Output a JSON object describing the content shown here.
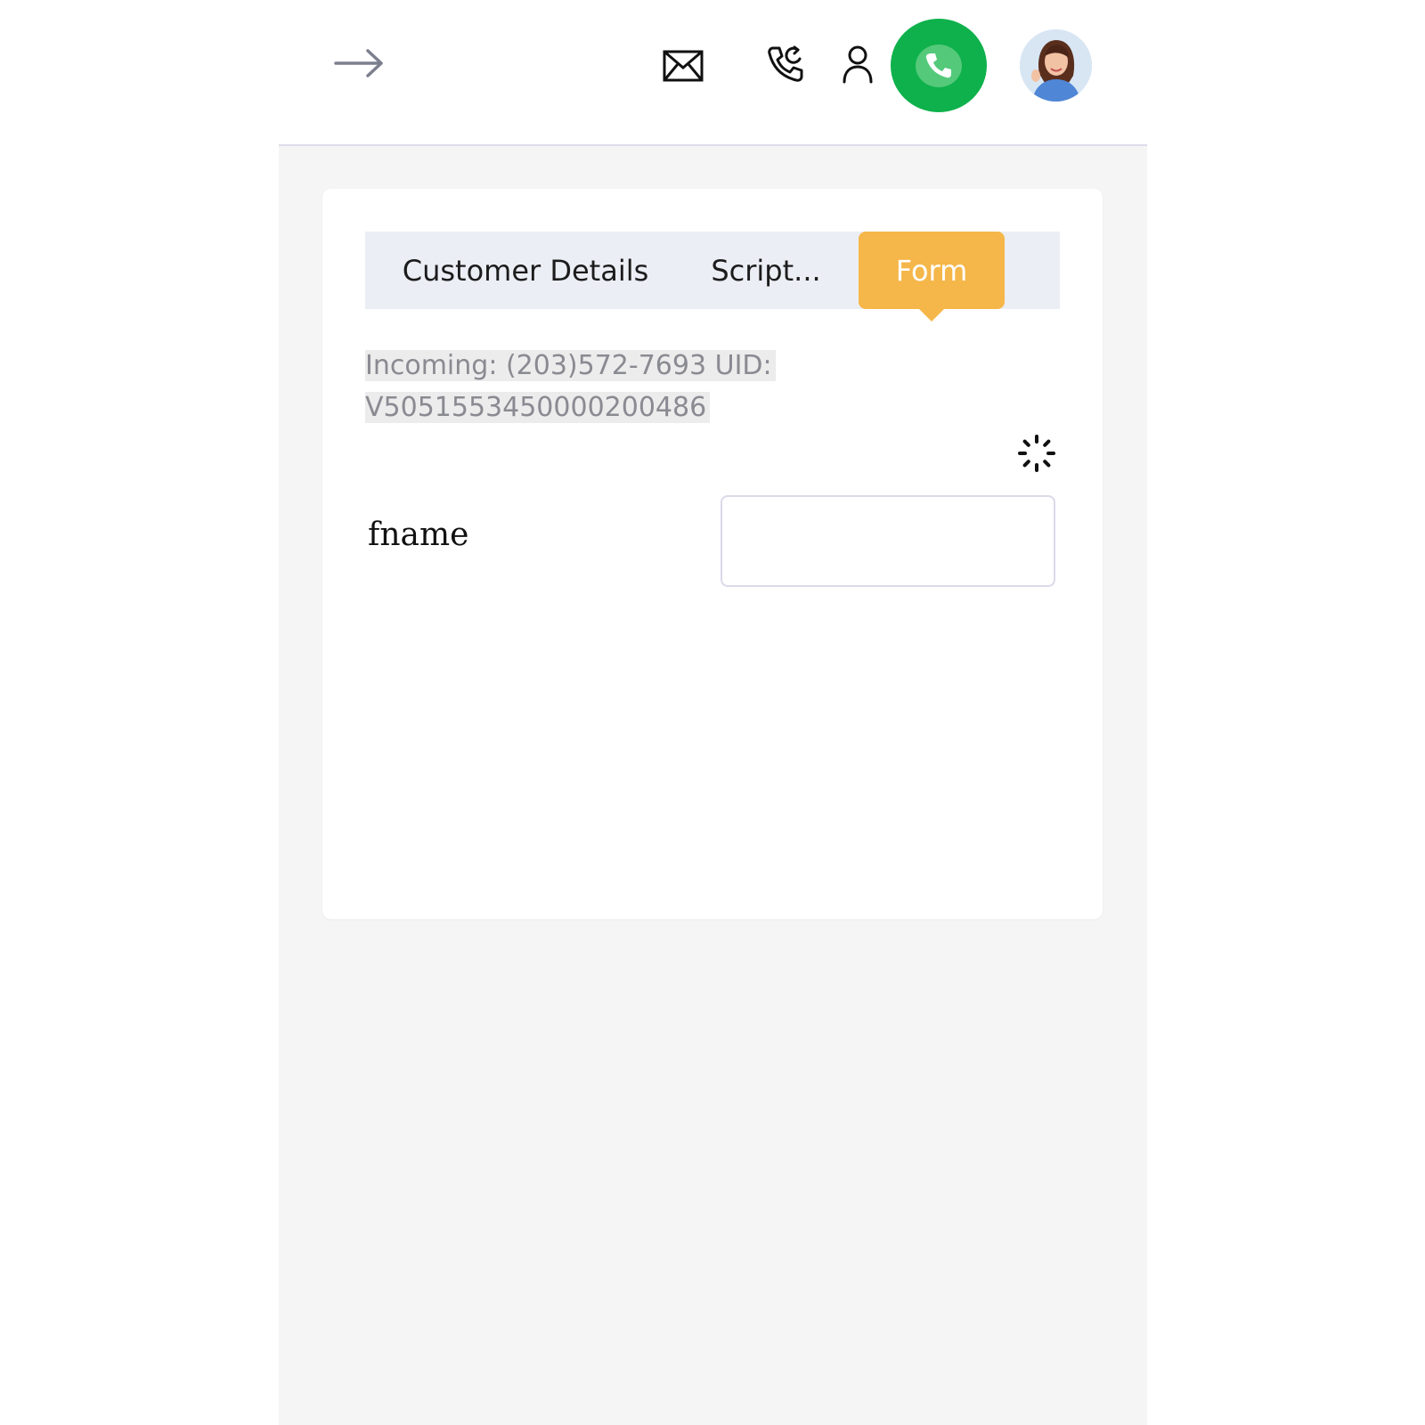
{
  "header": {
    "icons": [
      "arrow-right-icon",
      "mail-icon",
      "phone-callback-icon",
      "user-icon",
      "phone-icon",
      "avatar"
    ],
    "call_button_color": "#0eb14b"
  },
  "tabs": [
    {
      "label": "Customer Details",
      "active": false
    },
    {
      "label": "Script...",
      "active": false
    },
    {
      "label": "Form",
      "active": true
    }
  ],
  "active_tab_color": "#f5b749",
  "call_info": {
    "line1": "Incoming: (203)572-7693 UID:",
    "line2": "V5051553450000200486"
  },
  "form": {
    "fields": [
      {
        "label": "fname",
        "value": "",
        "placeholder": ""
      }
    ]
  }
}
